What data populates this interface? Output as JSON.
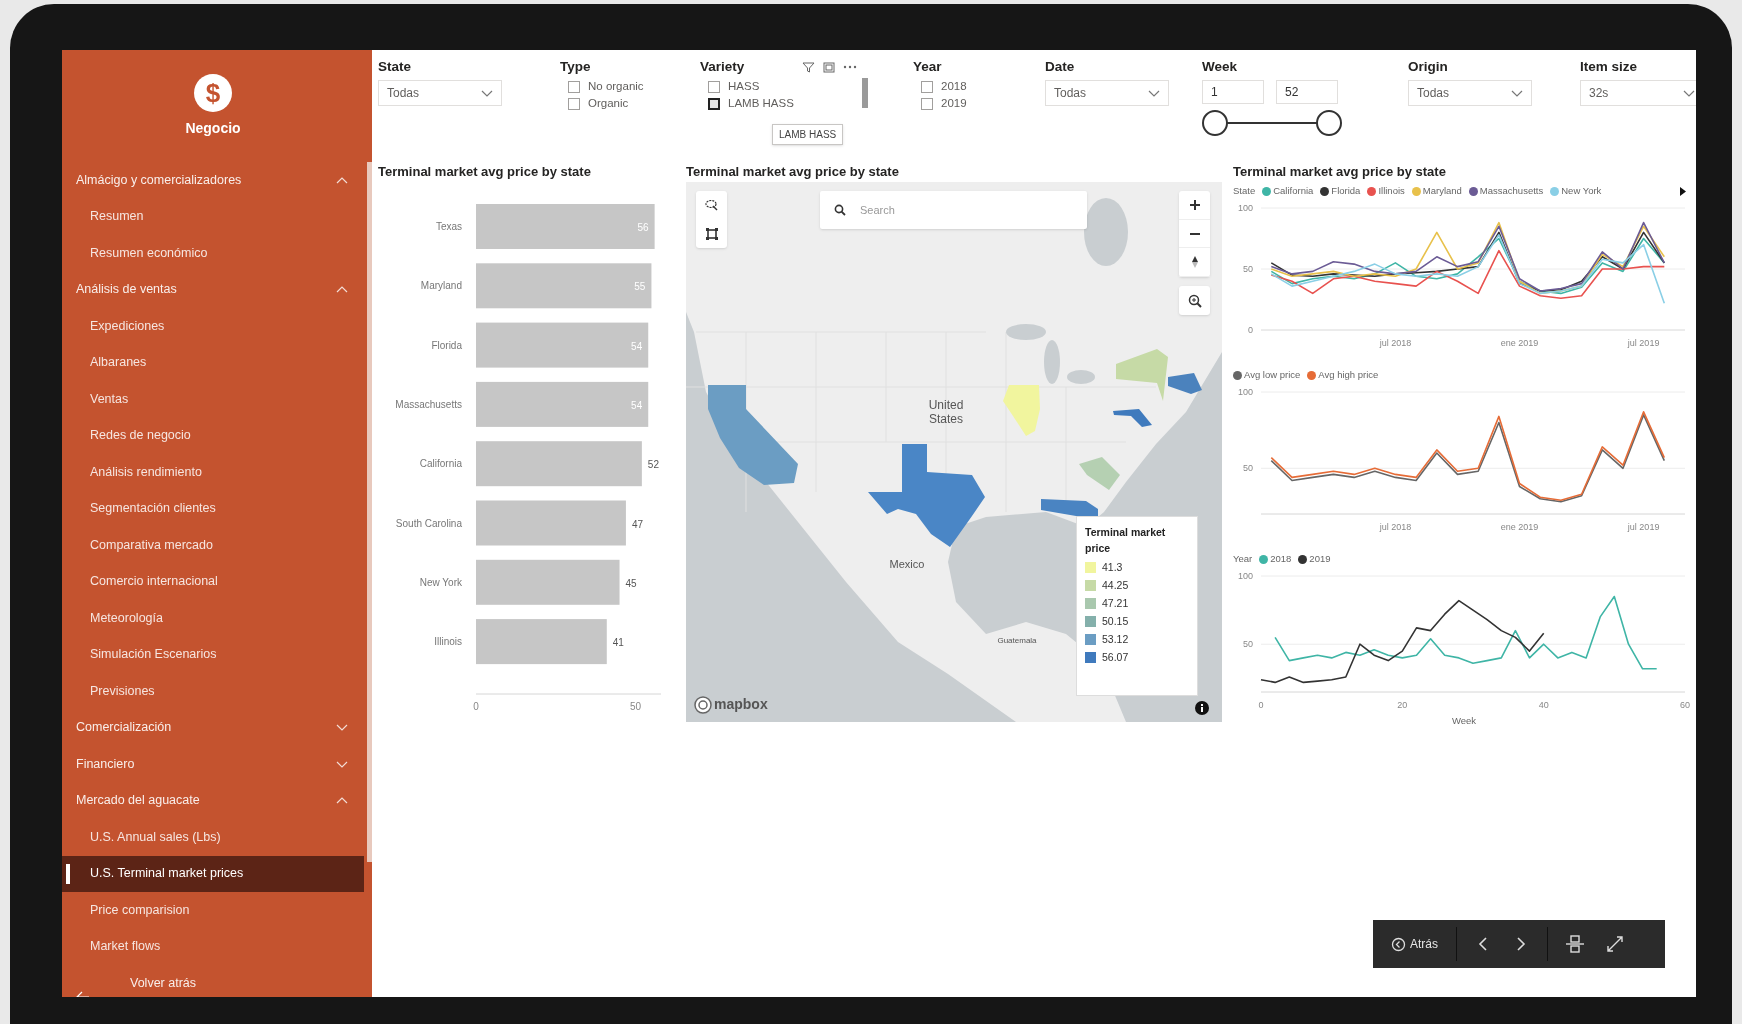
{
  "sidebar": {
    "logo_symbol": "$",
    "title": "Negocio",
    "sections": [
      {
        "label": "Almácigo y comercializadores",
        "expanded": true,
        "children": [
          {
            "label": "Resumen",
            "selected": false
          },
          {
            "label": "Resumen económico",
            "selected": false
          }
        ]
      },
      {
        "label": "Análisis de ventas",
        "expanded": true,
        "children": [
          {
            "label": "Expediciones",
            "selected": false
          },
          {
            "label": "Albaranes",
            "selected": false
          },
          {
            "label": "Ventas",
            "selected": false
          },
          {
            "label": "Redes de negocio",
            "selected": false
          },
          {
            "label": "Análisis rendimiento",
            "selected": false
          },
          {
            "label": "Segmentación clientes",
            "selected": false
          },
          {
            "label": "Comparativa mercado",
            "selected": false
          },
          {
            "label": "Comercio internacional",
            "selected": false
          },
          {
            "label": "Meteorología",
            "selected": false
          },
          {
            "label": "Simulación Escenarios",
            "selected": false
          },
          {
            "label": "Previsiones",
            "selected": false
          }
        ]
      },
      {
        "label": "Comercialización",
        "expanded": false
      },
      {
        "label": "Financiero",
        "expanded": false
      },
      {
        "label": "Mercado del aguacate",
        "expanded": true,
        "children": [
          {
            "label": "U.S. Annual sales (Lbs)",
            "selected": false
          },
          {
            "label": "U.S. Terminal market prices",
            "selected": true
          },
          {
            "label": "Price comparision",
            "selected": false
          },
          {
            "label": "Market flows",
            "selected": false
          }
        ]
      }
    ],
    "back_link": "Volver atrás"
  },
  "filters": [
    {
      "kind": "dropdown",
      "label": "State",
      "value": "Todas"
    },
    {
      "kind": "checklist",
      "label": "Type",
      "options": [
        {
          "label": "No organic",
          "checked": false,
          "hovered": false
        },
        {
          "label": "Organic",
          "checked": false,
          "hovered": false
        }
      ]
    },
    {
      "kind": "checklist",
      "label": "Variety",
      "header_icons": true,
      "options": [
        {
          "label": "HASS",
          "checked": false,
          "hovered": false
        },
        {
          "label": "LAMB HASS",
          "checked": false,
          "hovered": true
        }
      ],
      "tooltip": "LAMB HASS"
    },
    {
      "kind": "checklist",
      "label": "Year",
      "options": [
        {
          "label": "2018",
          "checked": false,
          "hovered": false
        },
        {
          "label": "2019",
          "checked": false,
          "hovered": false
        }
      ]
    },
    {
      "kind": "dropdown",
      "label": "Date",
      "value": "Todas"
    },
    {
      "kind": "range",
      "label": "Week",
      "from": "1",
      "to": "52",
      "range_start": {
        "level": 0
      },
      "range_end": {
        "level": 1
      }
    },
    {
      "kind": "dropdown",
      "label": "Origin",
      "value": "Todas"
    },
    {
      "kind": "dropdown",
      "label": "Item size",
      "value": "32s"
    }
  ],
  "bar_panel": {
    "chart_data": {
      "type": "bar",
      "orientation": "horizontal",
      "title": "Terminal market avg price by state",
      "categories": [
        "Texas",
        "Maryland",
        "Florida",
        "Massachusetts",
        "California",
        "South Carolina",
        "New York",
        "Illinois"
      ],
      "series": [
        {
          "color": "#c6c6c6",
          "values": [
            56,
            55,
            54,
            54,
            52,
            47,
            45,
            41
          ]
        }
      ],
      "xlim": [
        0,
        58
      ],
      "xticks": [
        0,
        50
      ],
      "data_labels": true
    }
  },
  "map_panel": {
    "title": "Terminal market avg price by state",
    "search_placeholder": "Search",
    "labels": [
      {
        "kind": "country",
        "text": "United States"
      },
      {
        "kind": "country",
        "text": "Mexico"
      },
      {
        "kind": "small",
        "text": "Guatemala"
      }
    ],
    "regions": [
      {
        "kind": "california",
        "color": "#6b9dc3"
      },
      {
        "kind": "texas",
        "color": "#4a86c6"
      },
      {
        "kind": "illinois",
        "color": "#f1f59e"
      },
      {
        "kind": "new_york",
        "color": "#c6daa6"
      },
      {
        "kind": "massachusetts",
        "color": "#4b82bd"
      },
      {
        "kind": "maryland",
        "color": "#3f7abd"
      },
      {
        "kind": "south_carolina",
        "color": "#b5d0b2"
      },
      {
        "kind": "florida",
        "color": "#4a84c2"
      }
    ],
    "legend": {
      "title": "Terminal market price",
      "items": [
        {
          "label": "41.3",
          "color": "#f1f59e"
        },
        {
          "label": "44.25",
          "color": "#c6daa6"
        },
        {
          "label": "47.21",
          "color": "#a9c8ae"
        },
        {
          "label": "50.15",
          "color": "#84b0ab"
        },
        {
          "label": "53.12",
          "color": "#6b9dc3"
        },
        {
          "label": "56.07",
          "color": "#3f7abd"
        }
      ]
    },
    "attribution": "mapbox"
  },
  "line_panel": {
    "title": "Terminal market avg price by state",
    "charts": [
      {
        "legend_title": "State",
        "legend_more": true,
        "chart_data": {
          "type": "line",
          "categories": [
            null,
            null,
            null,
            null,
            null,
            null,
            "jul 2018",
            null,
            null,
            null,
            null,
            null,
            "ene 2019",
            null,
            null,
            null,
            null,
            null,
            "jul 2019",
            null
          ],
          "ylim": [
            0,
            100
          ],
          "yticks": [
            0,
            50,
            100
          ],
          "series": [
            {
              "name": "California",
              "color": "#3fb5a6",
              "values": [
                48,
                38,
                42,
                44,
                42,
                46,
                55,
                44,
                42,
                46,
                60,
                75,
                40,
                32,
                30,
                35,
                55,
                48,
                75,
                55
              ]
            },
            {
              "name": "Florida",
              "color": "#333333",
              "values": [
                55,
                45,
                44,
                46,
                45,
                44,
                46,
                47,
                48,
                50,
                52,
                80,
                38,
                32,
                33,
                40,
                60,
                50,
                80,
                55
              ]
            },
            {
              "name": "Illinois",
              "color": "#e8524f",
              "values": [
                45,
                40,
                30,
                42,
                44,
                40,
                38,
                36,
                48,
                40,
                30,
                65,
                36,
                28,
                26,
                28,
                50,
                50,
                52,
                52
              ]
            },
            {
              "name": "Maryland",
              "color": "#e8c14b",
              "values": [
                50,
                44,
                46,
                48,
                44,
                46,
                44,
                50,
                80,
                50,
                55,
                88,
                40,
                30,
                32,
                36,
                62,
                52,
                85,
                60
              ]
            },
            {
              "name": "Massachusetts",
              "color": "#6b5b95",
              "values": [
                52,
                46,
                48,
                56,
                54,
                48,
                46,
                48,
                60,
                52,
                56,
                85,
                42,
                32,
                34,
                38,
                64,
                50,
                88,
                55
              ]
            },
            {
              "name": "New York",
              "color": "#8acfe6",
              "values": [
                46,
                36,
                40,
                44,
                48,
                54,
                46,
                44,
                46,
                44,
                52,
                78,
                38,
                30,
                32,
                36,
                58,
                55,
                70,
                22
              ]
            }
          ]
        }
      },
      {
        "chart_data": {
          "type": "line",
          "categories": [
            null,
            null,
            null,
            null,
            null,
            null,
            "jul 2018",
            null,
            null,
            null,
            null,
            null,
            "ene 2019",
            null,
            null,
            null,
            null,
            null,
            "jul 2019",
            null
          ],
          "ylim": [
            20,
            100
          ],
          "yticks": [
            50,
            100
          ],
          "series": [
            {
              "name": "Avg low price",
              "color": "#666666",
              "values": [
                55,
                42,
                44,
                46,
                44,
                48,
                44,
                42,
                60,
                46,
                48,
                80,
                38,
                30,
                28,
                32,
                62,
                50,
                85,
                55
              ]
            },
            {
              "name": "Avg high price",
              "color": "#e66c37",
              "values": [
                57,
                44,
                46,
                48,
                46,
                50,
                46,
                44,
                62,
                48,
                50,
                84,
                40,
                31,
                29,
                33,
                64,
                52,
                87,
                57
              ]
            }
          ]
        }
      },
      {
        "legend_title": "Year",
        "chart_data": {
          "type": "line",
          "xlabel": "Week",
          "x": [
            0,
            2,
            4,
            6,
            8,
            10,
            12,
            14,
            16,
            18,
            20,
            22,
            24,
            26,
            28,
            30,
            32,
            34,
            36,
            38,
            40,
            42,
            44,
            46,
            48,
            50,
            52,
            54,
            56
          ],
          "xlim": [
            0,
            60
          ],
          "ylim": [
            15,
            100
          ],
          "yticks": [
            50,
            100
          ],
          "xticks": [
            0,
            20,
            40,
            60
          ],
          "series": [
            {
              "name": "2018",
              "color": "#3fb5a6",
              "values": [
                null,
                55,
                38,
                40,
                42,
                40,
                44,
                42,
                46,
                42,
                40,
                42,
                54,
                42,
                40,
                36,
                38,
                40,
                60,
                40,
                50,
                40,
                44,
                40,
                70,
                85,
                50,
                32,
                32
              ]
            },
            {
              "name": "2019",
              "color": "#333333",
              "values": [
                24,
                22,
                26,
                22,
                23,
                24,
                26,
                50,
                42,
                38,
                45,
                62,
                60,
                72,
                82,
                75,
                68,
                60,
                55,
                45,
                58,
                null,
                null,
                null,
                null,
                null,
                null,
                null,
                null
              ]
            }
          ]
        }
      }
    ]
  },
  "navigation": {
    "back_label": "Atrás"
  }
}
